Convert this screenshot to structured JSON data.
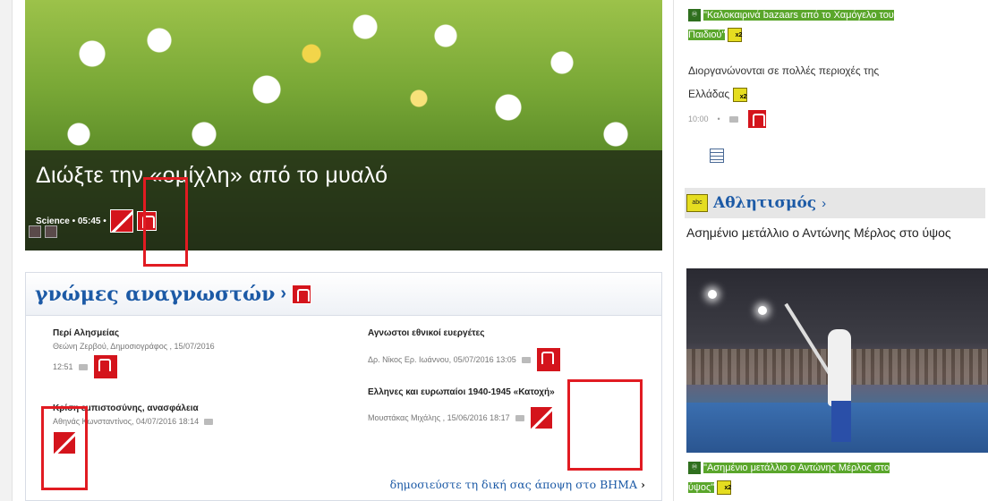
{
  "hero": {
    "title": "Διώξτε την «ομίχλη» από το μυαλό",
    "meta": "Science • 05:45 •"
  },
  "readers": {
    "title": "γνώμες αναγνωστών",
    "arrow": "›",
    "articles": [
      {
        "title": "Περί Αλησμείας",
        "meta": "Θεώνη Ζερβού, Δημοσιογράφος , 15/07/2016",
        "time": "12:51"
      },
      {
        "title": "Αγνωστοι εθνικοί ευεργέτες",
        "meta": "Δρ. Νίκος Ερ. Ιωάννου, 05/07/2016 13:05"
      },
      {
        "title": "Κρίση εμπιστοσύνης, ανασφάλεια",
        "meta": "Αθηνάς Κωνσταντίνος, 04/07/2016 18:14"
      },
      {
        "title": "Ελληνες και ευρωπαίοι 1940-1945 «Κατοχή»",
        "meta": "Μουστάκας Μιχάλης , 15/06/2016 18:17"
      }
    ],
    "publish_label": "δημοσιεύστε τη δική σας άποψη στο ΒΗΜΑ",
    "publish_arrow": "›"
  },
  "sidebar": {
    "top_link_1": "\"Καλοκαιρινά bazaars από το Χαμόγελο του",
    "top_link_2": "Παιδιού\"",
    "top_desc_1": "Διοργανώνονται σε πολλές περιοχές της",
    "top_desc_2": "Ελλάδας",
    "time": "10:00",
    "dot": "•",
    "section_title": "Αθλητισμός",
    "section_arrow": "›",
    "story": "Ασημένιο μετάλλιο ο Αντώνης Μέρλος στο ύψος",
    "bottom_link_1": "\"Ασημένιο μετάλλιο ο Αντώνης Μέρλος στο",
    "bottom_link_2": "ύψος\""
  },
  "colors": {
    "brand_blue": "#1c5aa6",
    "highlight_green": "#5aa62b",
    "highlight_yellow": "#e5dd20",
    "annotation_red": "#e11b22"
  }
}
